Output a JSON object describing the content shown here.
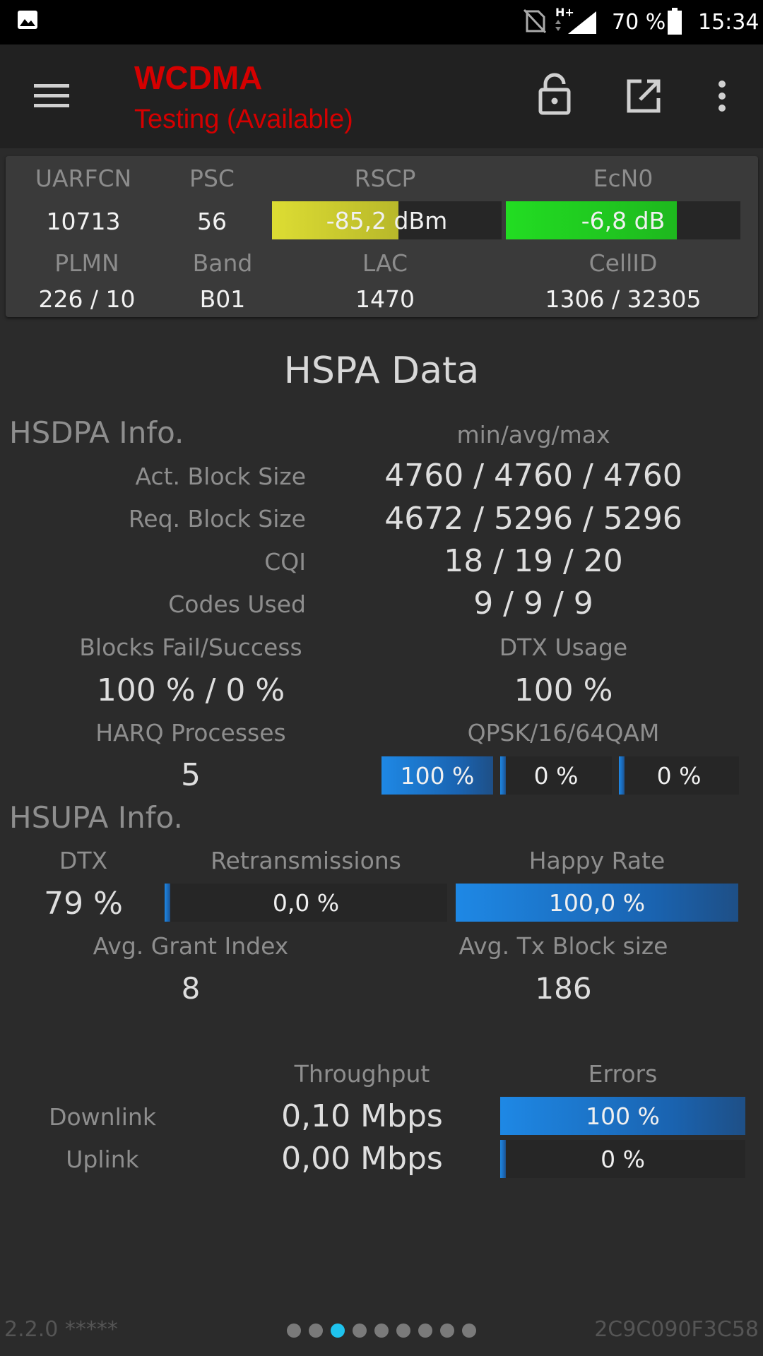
{
  "status_bar": {
    "battery": "70 %",
    "time": "15:34",
    "network": "H+"
  },
  "toolbar": {
    "title": "WCDMA",
    "subtitle": "Testing (Available)",
    "icons": [
      "menu-icon",
      "lock-icon",
      "open-external-icon",
      "more-vert-icon"
    ]
  },
  "cell": {
    "headers": {
      "uarfcn": "UARFCN",
      "psc": "PSC",
      "rscp": "RSCP",
      "ecn0": "EcN0",
      "plmn": "PLMN",
      "band": "Band",
      "lac": "LAC",
      "cellid": "CellID"
    },
    "uarfcn": "10713",
    "psc": "56",
    "rscp": "-85,2 dBm",
    "rscp_level": 0.55,
    "ecn0": "-6,8 dB",
    "ecn0_level": 0.73,
    "plmn": "226 / 10",
    "band": "B01",
    "lac": "1470",
    "cellid": "1306 / 32305",
    "colors": {
      "rscp": "#dddd33",
      "ecn0": "#22dd22"
    }
  },
  "hspa": {
    "title": "HSPA Data",
    "hsdpa": {
      "title": "HSDPA Info.",
      "minavgmax_label": "min/avg/max",
      "rows": [
        {
          "label": "Act. Block Size",
          "value": "4760 / 4760 / 4760"
        },
        {
          "label": "Req. Block Size",
          "value": "4672 / 5296 / 5296"
        },
        {
          "label": "CQI",
          "value": "18 / 19 / 20"
        },
        {
          "label": "Codes Used",
          "value": "9 / 9 / 9"
        }
      ],
      "blocks_label": "Blocks Fail/Success",
      "blocks_value": "100 % / 0 %",
      "dtx_label": "DTX Usage",
      "dtx_value": "100 %",
      "harq_label": "HARQ Processes",
      "harq_value": "5",
      "mod_label": "QPSK/16/64QAM",
      "mod": [
        {
          "text": "100 %",
          "level": 1.0
        },
        {
          "text": "0 %",
          "level": 0.0
        },
        {
          "text": "0 %",
          "level": 0.0
        }
      ]
    },
    "hsupa": {
      "title": "HSUPA Info.",
      "dtx_label": "DTX",
      "dtx_value": "79 %",
      "retrans_label": "Retransmissions",
      "retrans_value": "0,0 %",
      "retrans_level": 0.0,
      "happy_label": "Happy Rate",
      "happy_value": "100,0 %",
      "happy_level": 1.0,
      "grant_label": "Avg. Grant Index",
      "grant_value": "8",
      "txblock_label": "Avg. Tx Block size",
      "txblock_value": "186"
    },
    "throughput": {
      "throughput_label": "Throughput",
      "errors_label": "Errors",
      "downlink_label": "Downlink",
      "downlink_value": "0,10 Mbps",
      "downlink_errors": "100 %",
      "downlink_error_level": 1.0,
      "uplink_label": "Uplink",
      "uplink_value": "0,00 Mbps",
      "uplink_errors": "0 %",
      "uplink_error_level": 0.0
    }
  },
  "footer": {
    "version": "2.2.0 *****",
    "device_id": "2C9C090F3C58",
    "pages": 9,
    "active_page": 3
  }
}
